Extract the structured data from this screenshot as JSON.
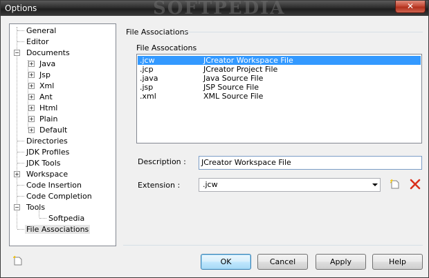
{
  "window": {
    "title": "Options",
    "watermark": "SOFTPEDIA",
    "close_label": "✕"
  },
  "tree": {
    "items": [
      {
        "label": "General"
      },
      {
        "label": "Editor"
      },
      {
        "label": "Documents"
      },
      {
        "label": "Java"
      },
      {
        "label": "Jsp"
      },
      {
        "label": "Xml"
      },
      {
        "label": "Ant"
      },
      {
        "label": "Html"
      },
      {
        "label": "Plain"
      },
      {
        "label": "Default"
      },
      {
        "label": "Directories"
      },
      {
        "label": "JDK Profiles"
      },
      {
        "label": "JDK Tools"
      },
      {
        "label": "Workspace"
      },
      {
        "label": "Code Insertion"
      },
      {
        "label": "Code Completion"
      },
      {
        "label": "Tools"
      },
      {
        "label": "Softpedia"
      },
      {
        "label": "File Associations"
      }
    ],
    "selected": "File Associations"
  },
  "panel": {
    "group_title": "File Associations",
    "list_label": "File Assocations",
    "associations": [
      {
        "ext": ".jcw",
        "desc": "JCreator Workspace File"
      },
      {
        "ext": ".jcp",
        "desc": "JCreator Project File"
      },
      {
        "ext": ".java",
        "desc": "Java Source File"
      },
      {
        "ext": ".jsp",
        "desc": "JSP Source File"
      },
      {
        "ext": ".xml",
        "desc": "XML Source File"
      }
    ],
    "selected_index": 0,
    "description_label": "Description :",
    "description_value": "JCreator Workspace File",
    "extension_label": "Extension :",
    "extension_value": ".jcw"
  },
  "icons": {
    "new_extension": "new-file-icon",
    "delete_extension": "delete-x-icon",
    "new_bottom": "new-file-icon"
  },
  "buttons": {
    "ok": "OK",
    "cancel": "Cancel",
    "apply": "Apply",
    "help": "Help"
  },
  "colors": {
    "selection": "#3399ff",
    "delete": "#d9301c"
  }
}
